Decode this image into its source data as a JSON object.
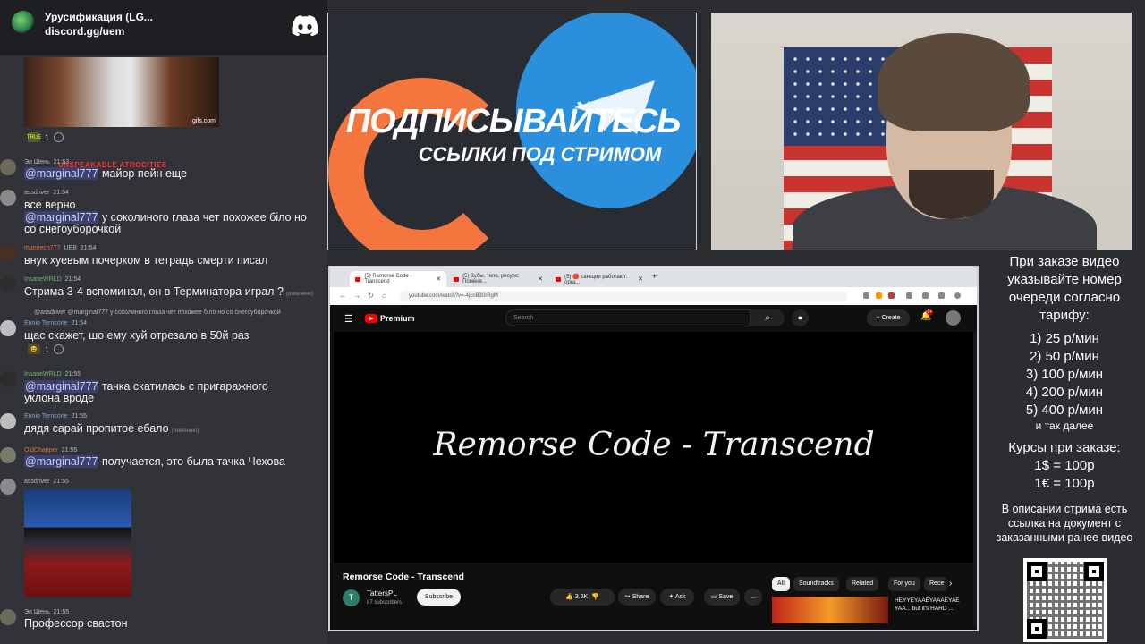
{
  "discord": {
    "server_name": "Урусификация (LG...",
    "server_link": "discord.gg/uem"
  },
  "chat": {
    "image1_caption": "UNSPEAKABLE ATROCITIES",
    "image1_source": "gifs.com",
    "reaction1_count": "1",
    "reaction2_count": "1",
    "messages": [
      {
        "user": "Эл Шень",
        "time": "21:53",
        "mention": "@marginal777",
        "text": " майор пейн еще"
      },
      {
        "user": "assdriver",
        "time": "21:54",
        "text": "все верно"
      },
      {
        "mention": "@marginal777",
        "text": " у соколиного глаза чет похожее біло но"
      },
      {
        "text": "со снегоуборочкой"
      },
      {
        "user": "maneech777",
        "badge": "UEB",
        "time": "21:54",
        "text": "внук хуевым почерком в тетрадь смерти писал"
      },
      {
        "user": "InsaneWRLD",
        "time": "21:54",
        "text": "Стрима 3-4 вспоминал, он в Терминатора играл ?",
        "edited": "(изменено)"
      },
      {
        "reply": "@assdriver @marginal777 у соколиного глаза чет похожее біло но со снегоуборочкой"
      },
      {
        "user": "Ennio Terricone",
        "time": "21:54",
        "text": "щас скажет, шо ему хуй отрезало в 50й раз"
      },
      {
        "user": "InsaneWRLD",
        "time": "21:55",
        "mention": "@marginal777",
        "text": " тачка скатилась с пригаражного"
      },
      {
        "text": "уклона вроде"
      },
      {
        "user": "Ennio Terricone",
        "time": "21:55",
        "text": "дядя сарай пропитое ебало",
        "edited": "(изменено)"
      },
      {
        "user": "OldChapper",
        "time": "21:55",
        "mention": "@marginal777",
        "text": " получается, это была тачка Чехова"
      },
      {
        "user": "assdriver",
        "time": "21:55"
      },
      {
        "user": "Эл Шень",
        "time": "21:55",
        "text": "Профессор свастон"
      }
    ]
  },
  "promo": {
    "line1": "ПОДПИСЫВАЙТЕСЬ",
    "line2": "ССЫЛКИ ПОД СТРИМОМ"
  },
  "browser": {
    "tabs": [
      "(5) Remorse Code - Transcend",
      "(5) Зубы, тело, ресурс: Поменя...",
      "(5) 🔴 санкции работают: орга..."
    ],
    "url": "youtube.com/watch?v=-4jcnB30rRgM"
  },
  "youtube": {
    "brand": "Premium",
    "search_placeholder": "Search",
    "create_label": "Create",
    "bell_count": "9+",
    "player_title": "Remorse Code - Transcend",
    "video_title": "Remorse Code - Transcend",
    "channel_initial": "T",
    "channel_name": "TattersPL",
    "channel_subs": "87 subscribers",
    "subscribe": "Subscribe",
    "likes": "3.2K",
    "share": "Share",
    "ask": "Ask",
    "save": "Save",
    "more": "...",
    "chips": [
      "All",
      "Soundtracks",
      "Related",
      "For you",
      "Rece"
    ],
    "rec_title": "HEYYEYAAEYAAAEYAE YAA... but it's HARD ..."
  },
  "side": {
    "intro": "При заказе видео указывайте номер очереди согласно тарифу:",
    "tariffs": [
      "1) 25 р/мин",
      "2) 50 р/мин",
      "3) 100 р/мин",
      "4) 200 р/мин",
      "5) 400 р/мин"
    ],
    "and_more": "и так далее",
    "rates_title": "Курсы при заказе:",
    "rates": [
      "1$ = 100р",
      "1€ = 100р"
    ],
    "note": "В описании стрима есть ссылка на документ с заказанными ранее видео"
  },
  "colors": {
    "discord_bg": "#313338",
    "mention_bg": "#3c4270",
    "yt_red": "#ff0000",
    "telegram": "#2a8fdc",
    "patreon": "#f4753d"
  }
}
